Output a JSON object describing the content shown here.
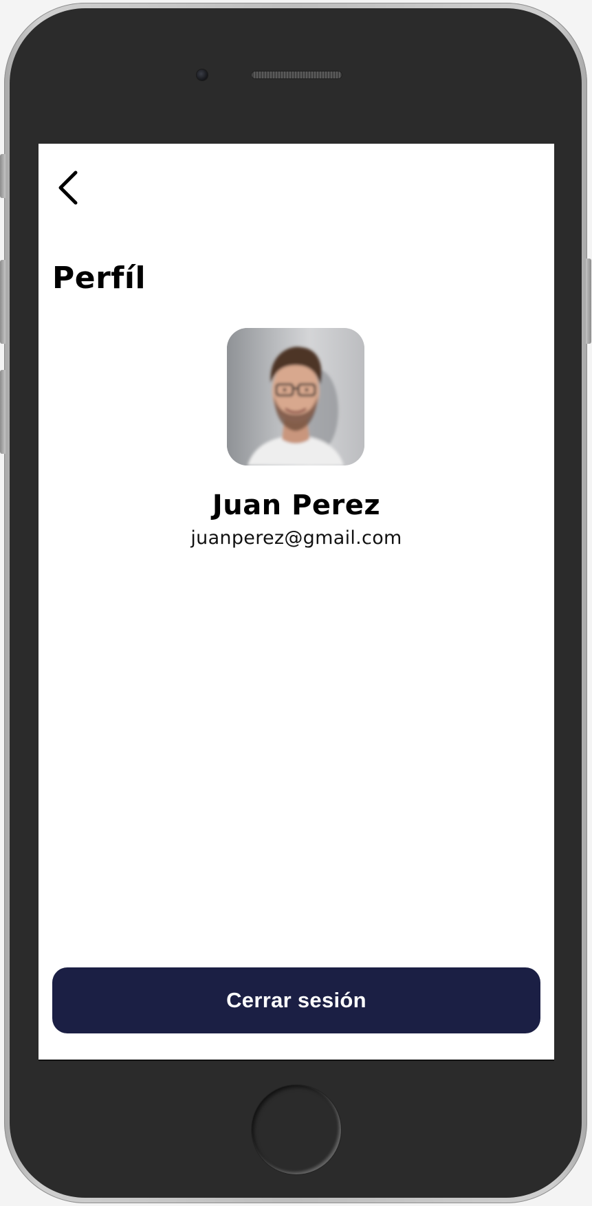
{
  "header": {
    "back_icon": "chevron-left-icon",
    "title": "Perfíl"
  },
  "profile": {
    "avatar": "profile-photo",
    "name": "Juan Perez",
    "email": "juanperez@gmail.com"
  },
  "actions": {
    "logout_label": "Cerrar sesión"
  },
  "colors": {
    "button_bg": "#1b1f44",
    "button_text": "#ffffff",
    "device_body": "#2b2b2b",
    "screen_bg": "#ffffff"
  }
}
